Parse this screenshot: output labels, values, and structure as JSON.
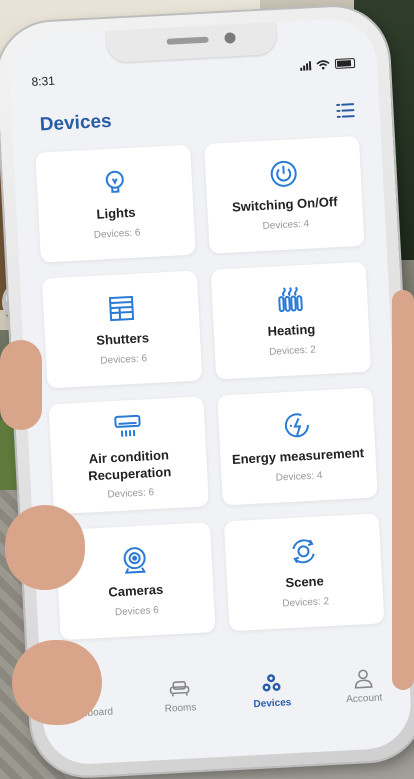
{
  "status_bar": {
    "time": "8:31"
  },
  "header": {
    "title": "Devices",
    "menu_icon": "list-icon"
  },
  "accent_color": "#2a5ca8",
  "devices": [
    {
      "name": "Lights",
      "count": "Devices: 6",
      "icon": "lightbulb-icon"
    },
    {
      "name": "Switching On/Off",
      "count": "Devices: 4",
      "icon": "power-icon"
    },
    {
      "name": "Shutters",
      "count": "Devices: 6",
      "icon": "shutter-icon"
    },
    {
      "name": "Heating",
      "count": "Devices: 2",
      "icon": "radiator-icon"
    },
    {
      "name": "Air condition Recuperation",
      "count": "Devices: 6",
      "icon": "air-conditioner-icon"
    },
    {
      "name": "Energy measurement",
      "count": "Devices: 4",
      "icon": "energy-icon"
    },
    {
      "name": "Cameras",
      "count": "Devices 6",
      "icon": "camera-icon"
    },
    {
      "name": "Scene",
      "count": "Devices: 2",
      "icon": "scene-icon"
    }
  ],
  "bottom_nav": [
    {
      "label": "Dashboard",
      "icon": "home-icon",
      "active": false
    },
    {
      "label": "Rooms",
      "icon": "sofa-icon",
      "active": false
    },
    {
      "label": "Devices",
      "icon": "devices-icon",
      "active": true
    },
    {
      "label": "Account",
      "icon": "user-icon",
      "active": false
    }
  ]
}
